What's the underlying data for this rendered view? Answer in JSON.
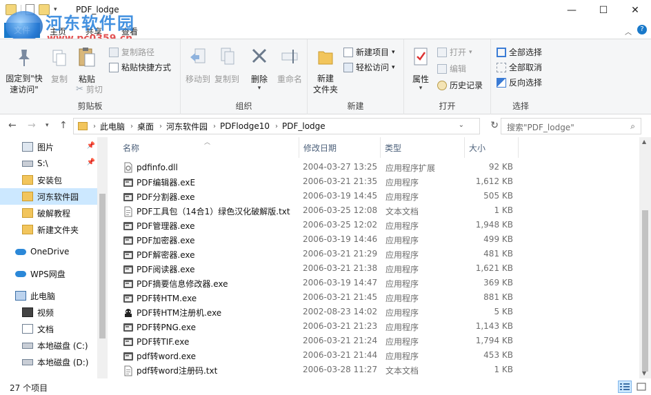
{
  "window": {
    "title": "PDF_lodge",
    "controls": {
      "minimize": "—",
      "maximize": "☐",
      "close": "✕"
    }
  },
  "watermark": {
    "title": "河东软件园",
    "url": "www.pc0359.cn"
  },
  "ribbon_tabs": {
    "file": "文件",
    "home": "主页",
    "share": "共享",
    "view": "查看"
  },
  "ribbon": {
    "clipboard": {
      "label": "剪贴板",
      "pin": "固定到\"快速访问\"",
      "copy": "复制",
      "paste": "粘贴",
      "copy_path": "复制路径",
      "paste_shortcut": "粘贴快捷方式",
      "cut": "剪切"
    },
    "organize": {
      "label": "组织",
      "move_to": "移动到",
      "copy_to": "复制到",
      "delete": "删除",
      "rename": "重命名"
    },
    "new": {
      "label": "新建",
      "new_folder": "新建\n文件夹",
      "new_item": "新建项目",
      "easy_access": "轻松访问"
    },
    "open": {
      "label": "打开",
      "properties": "属性",
      "open": "打开",
      "edit": "编辑",
      "history": "历史记录"
    },
    "select": {
      "label": "选择",
      "select_all": "全部选择",
      "select_none": "全部取消",
      "invert": "反向选择"
    }
  },
  "address": {
    "crumbs": [
      "此电脑",
      "桌面",
      "河东软件园",
      "PDFlodge10",
      "PDF_lodge"
    ],
    "search_placeholder": "搜索\"PDF_lodge\""
  },
  "nav": {
    "items": [
      {
        "label": "图片",
        "icon": "pictures-icon",
        "pinned": true
      },
      {
        "label": "S:\\",
        "icon": "drive-icon",
        "pinned": true
      },
      {
        "label": "安装包",
        "icon": "folder-icon"
      },
      {
        "label": "河东软件园",
        "icon": "folder-icon",
        "selected": true
      },
      {
        "label": "破解教程",
        "icon": "folder-icon"
      },
      {
        "label": "新建文件夹",
        "icon": "folder-icon"
      },
      {
        "label": "OneDrive",
        "icon": "cloud-icon"
      },
      {
        "label": "WPS网盘",
        "icon": "cloud-icon"
      },
      {
        "label": "此电脑",
        "icon": "computer-icon"
      },
      {
        "label": "视频",
        "icon": "video-icon"
      },
      {
        "label": "文档",
        "icon": "document-icon"
      },
      {
        "label": "本地磁盘 (C:)",
        "icon": "drive-icon"
      },
      {
        "label": "本地磁盘 (D:)",
        "icon": "drive-icon"
      }
    ]
  },
  "columns": {
    "name": "名称",
    "date": "修改日期",
    "type": "类型",
    "size": "大小"
  },
  "files": [
    {
      "name": "pdfinfo.dll",
      "date": "2004-03-27 13:25",
      "type": "应用程序扩展",
      "size": "92 KB",
      "icon": "dll"
    },
    {
      "name": "PDF编辑器.exE",
      "date": "2006-03-21 21:35",
      "type": "应用程序",
      "size": "1,612 KB",
      "icon": "exe"
    },
    {
      "name": "PDF分割器.exe",
      "date": "2006-03-19 14:45",
      "type": "应用程序",
      "size": "505 KB",
      "icon": "exe"
    },
    {
      "name": "PDF工具包（14合1）绿色汉化破解版.txt",
      "date": "2006-03-25 12:08",
      "type": "文本文档",
      "size": "1 KB",
      "icon": "txt"
    },
    {
      "name": "PDF管理器.exe",
      "date": "2006-03-25 12:02",
      "type": "应用程序",
      "size": "1,948 KB",
      "icon": "exe"
    },
    {
      "name": "PDF加密器.exe",
      "date": "2006-03-19 14:46",
      "type": "应用程序",
      "size": "499 KB",
      "icon": "exe"
    },
    {
      "name": "PDF解密器.exe",
      "date": "2006-03-21 21:29",
      "type": "应用程序",
      "size": "481 KB",
      "icon": "exe"
    },
    {
      "name": "PDF阅读器.exe",
      "date": "2006-03-21 21:38",
      "type": "应用程序",
      "size": "1,621 KB",
      "icon": "exe"
    },
    {
      "name": "PDF摘要信息修改器.exe",
      "date": "2006-03-19 14:47",
      "type": "应用程序",
      "size": "369 KB",
      "icon": "exe"
    },
    {
      "name": "PDF转HTM.exe",
      "date": "2006-03-21 21:45",
      "type": "应用程序",
      "size": "881 KB",
      "icon": "exe"
    },
    {
      "name": "PDF转HTM注册机.exe",
      "date": "2002-08-23 14:02",
      "type": "应用程序",
      "size": "5 KB",
      "icon": "keygen"
    },
    {
      "name": "PDF转PNG.exe",
      "date": "2006-03-21 21:23",
      "type": "应用程序",
      "size": "1,143 KB",
      "icon": "exe"
    },
    {
      "name": "PDF转TIF.exe",
      "date": "2006-03-21 21:24",
      "type": "应用程序",
      "size": "1,794 KB",
      "icon": "exe"
    },
    {
      "name": "pdf转word.exe",
      "date": "2006-03-21 21:44",
      "type": "应用程序",
      "size": "453 KB",
      "icon": "exe"
    },
    {
      "name": "pdf转word注册码.txt",
      "date": "2006-03-28 11:27",
      "type": "文本文档",
      "size": "1 KB",
      "icon": "txt"
    }
  ],
  "status": {
    "count": "27 个项目"
  }
}
